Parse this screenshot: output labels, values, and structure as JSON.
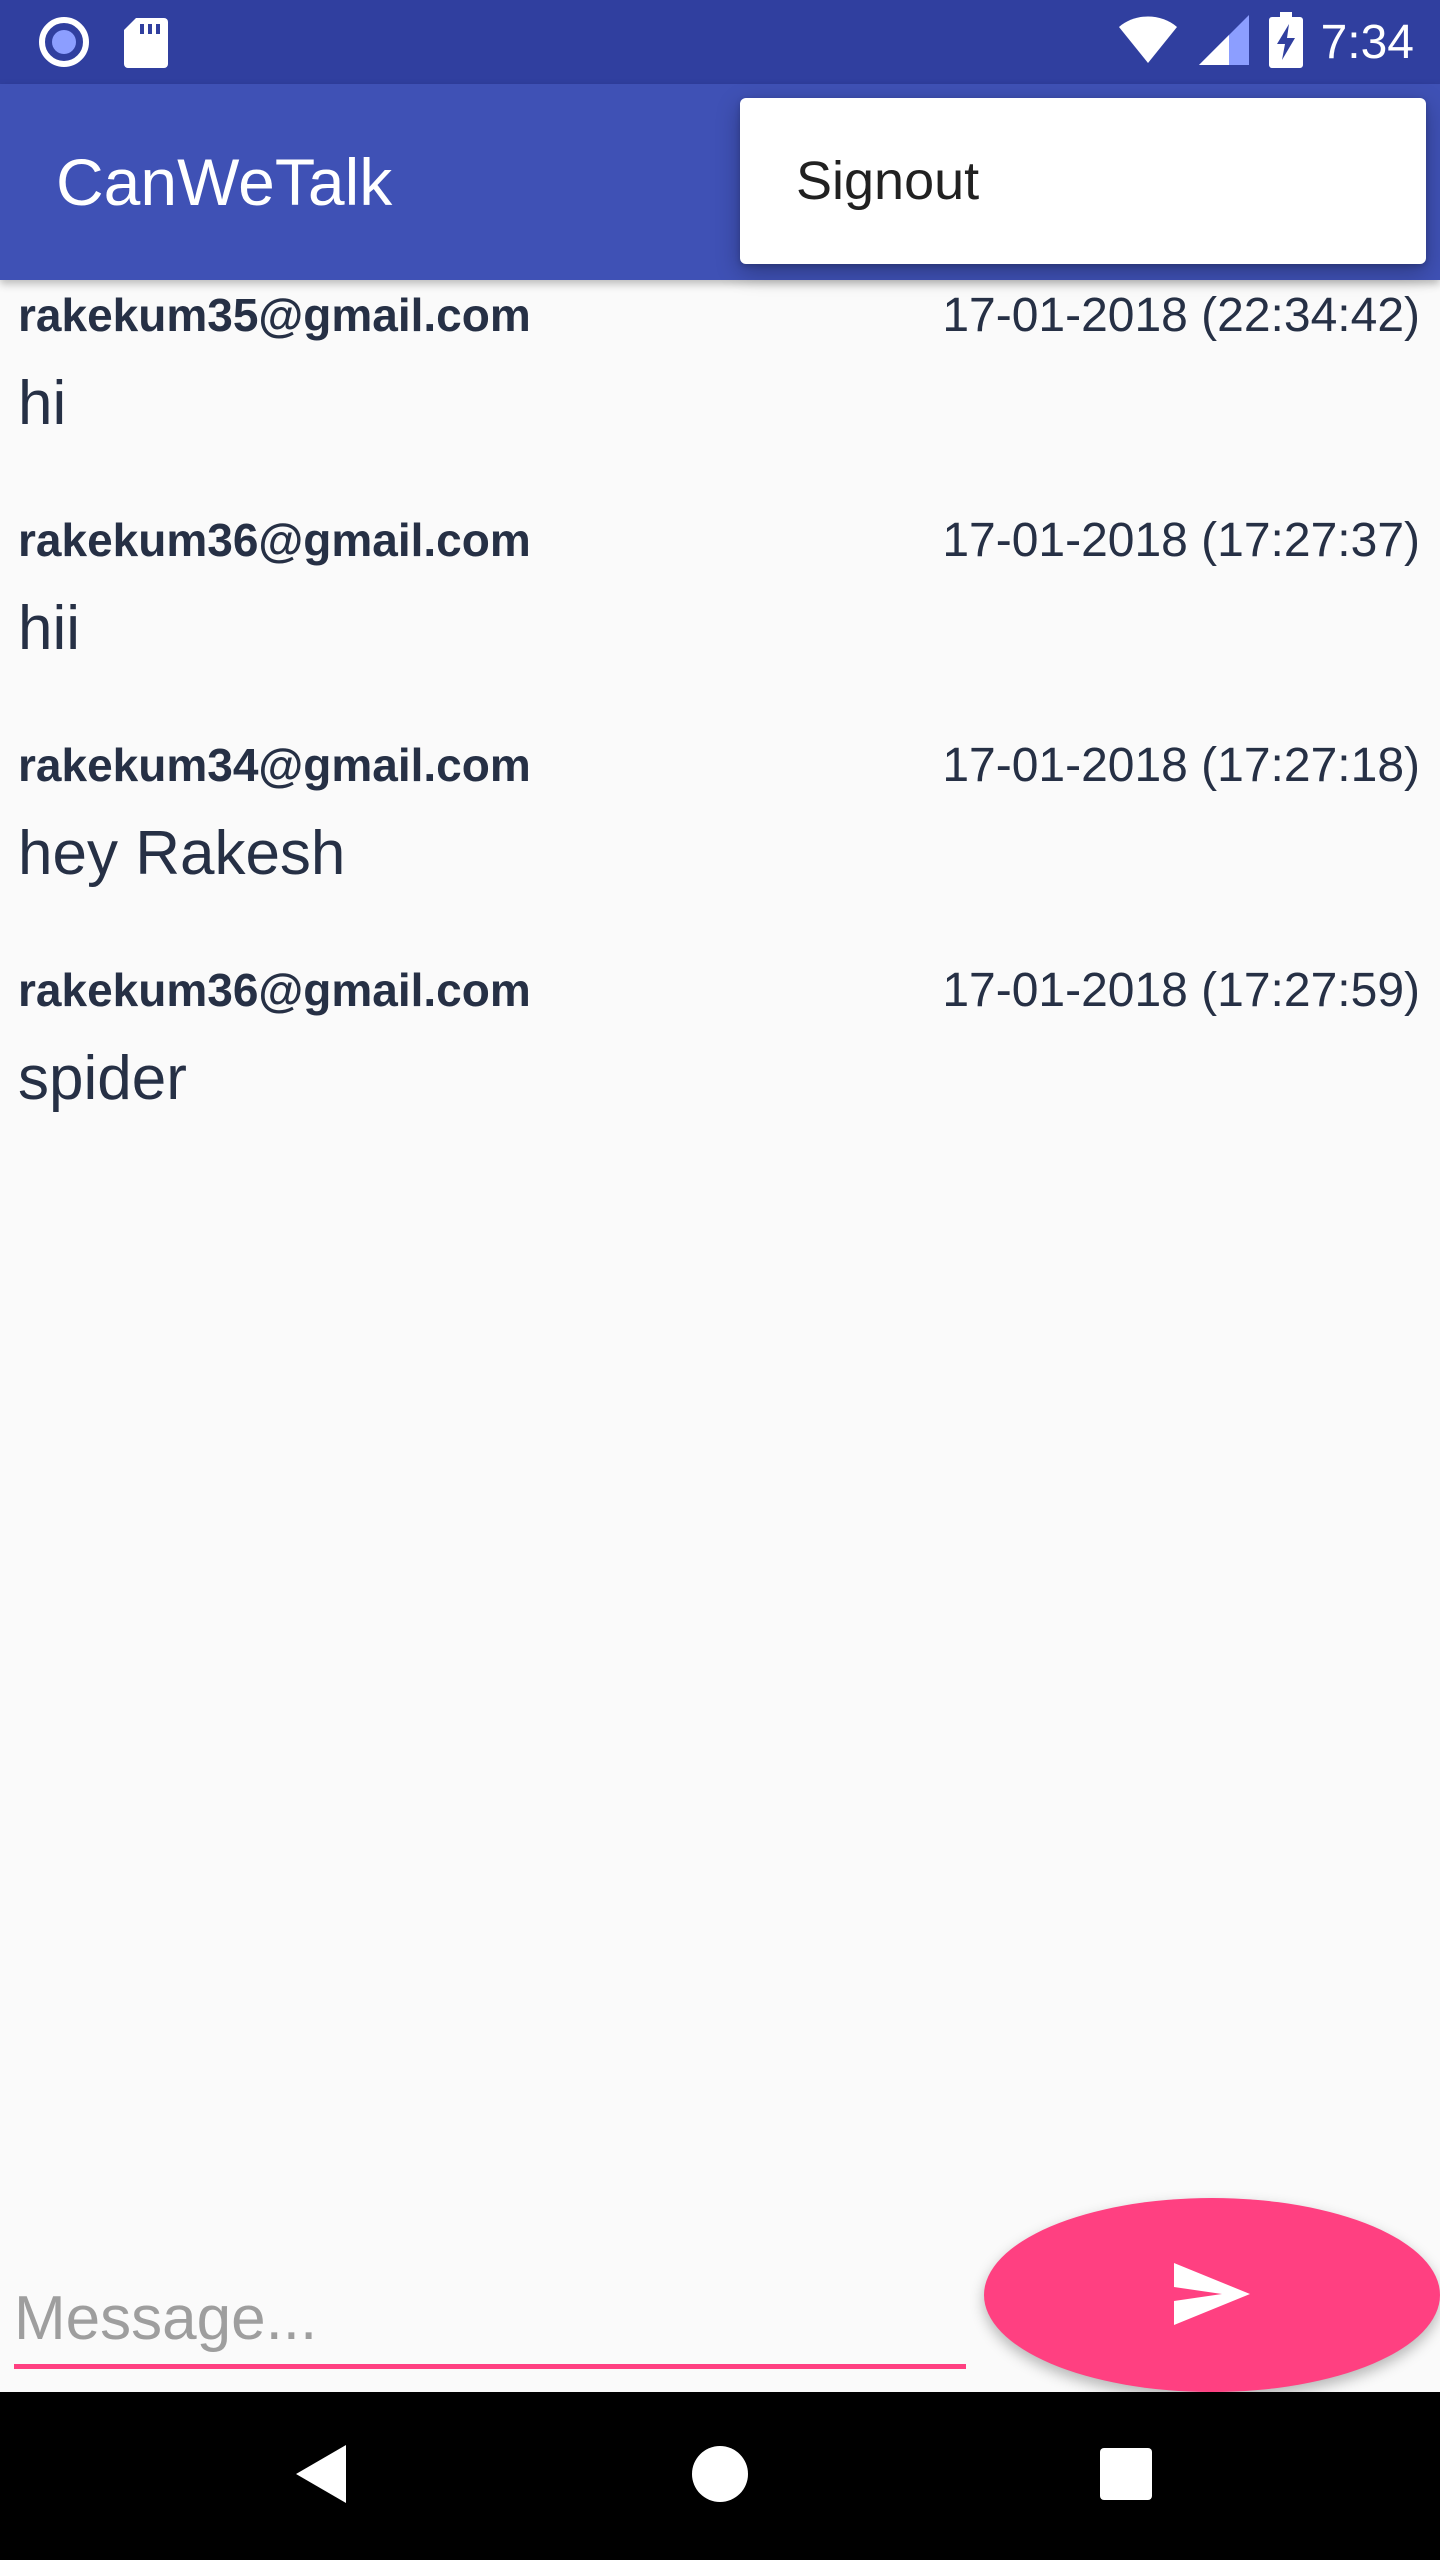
{
  "status_bar": {
    "time": "7:34",
    "icons": [
      "record-icon",
      "sd-card-icon",
      "wifi-icon",
      "signal-icon",
      "battery-charging-icon"
    ]
  },
  "app_bar": {
    "title": "CanWeTalk"
  },
  "menu": {
    "items": [
      {
        "label": "Signout"
      }
    ]
  },
  "messages": [
    {
      "sender": "rakekum35@gmail.com",
      "timestamp": "17-01-2018 (22:34:42)",
      "text": "hi"
    },
    {
      "sender": "rakekum36@gmail.com",
      "timestamp": "17-01-2018 (17:27:37)",
      "text": "hii"
    },
    {
      "sender": "rakekum34@gmail.com",
      "timestamp": "17-01-2018 (17:27:18)",
      "text": "hey Rakesh"
    },
    {
      "sender": "rakekum36@gmail.com",
      "timestamp": "17-01-2018 (17:27:59)",
      "text": "spider"
    }
  ],
  "composer": {
    "placeholder": "Message...",
    "value": "",
    "send_icon": "send-icon"
  },
  "nav_bar": {
    "icons": [
      "back-icon",
      "home-icon",
      "recents-icon"
    ]
  },
  "colors": {
    "status_bar": "#303f9f",
    "primary": "#3f51b5",
    "accent": "#ff4081",
    "text": "#263045",
    "background": "#fafafa"
  }
}
